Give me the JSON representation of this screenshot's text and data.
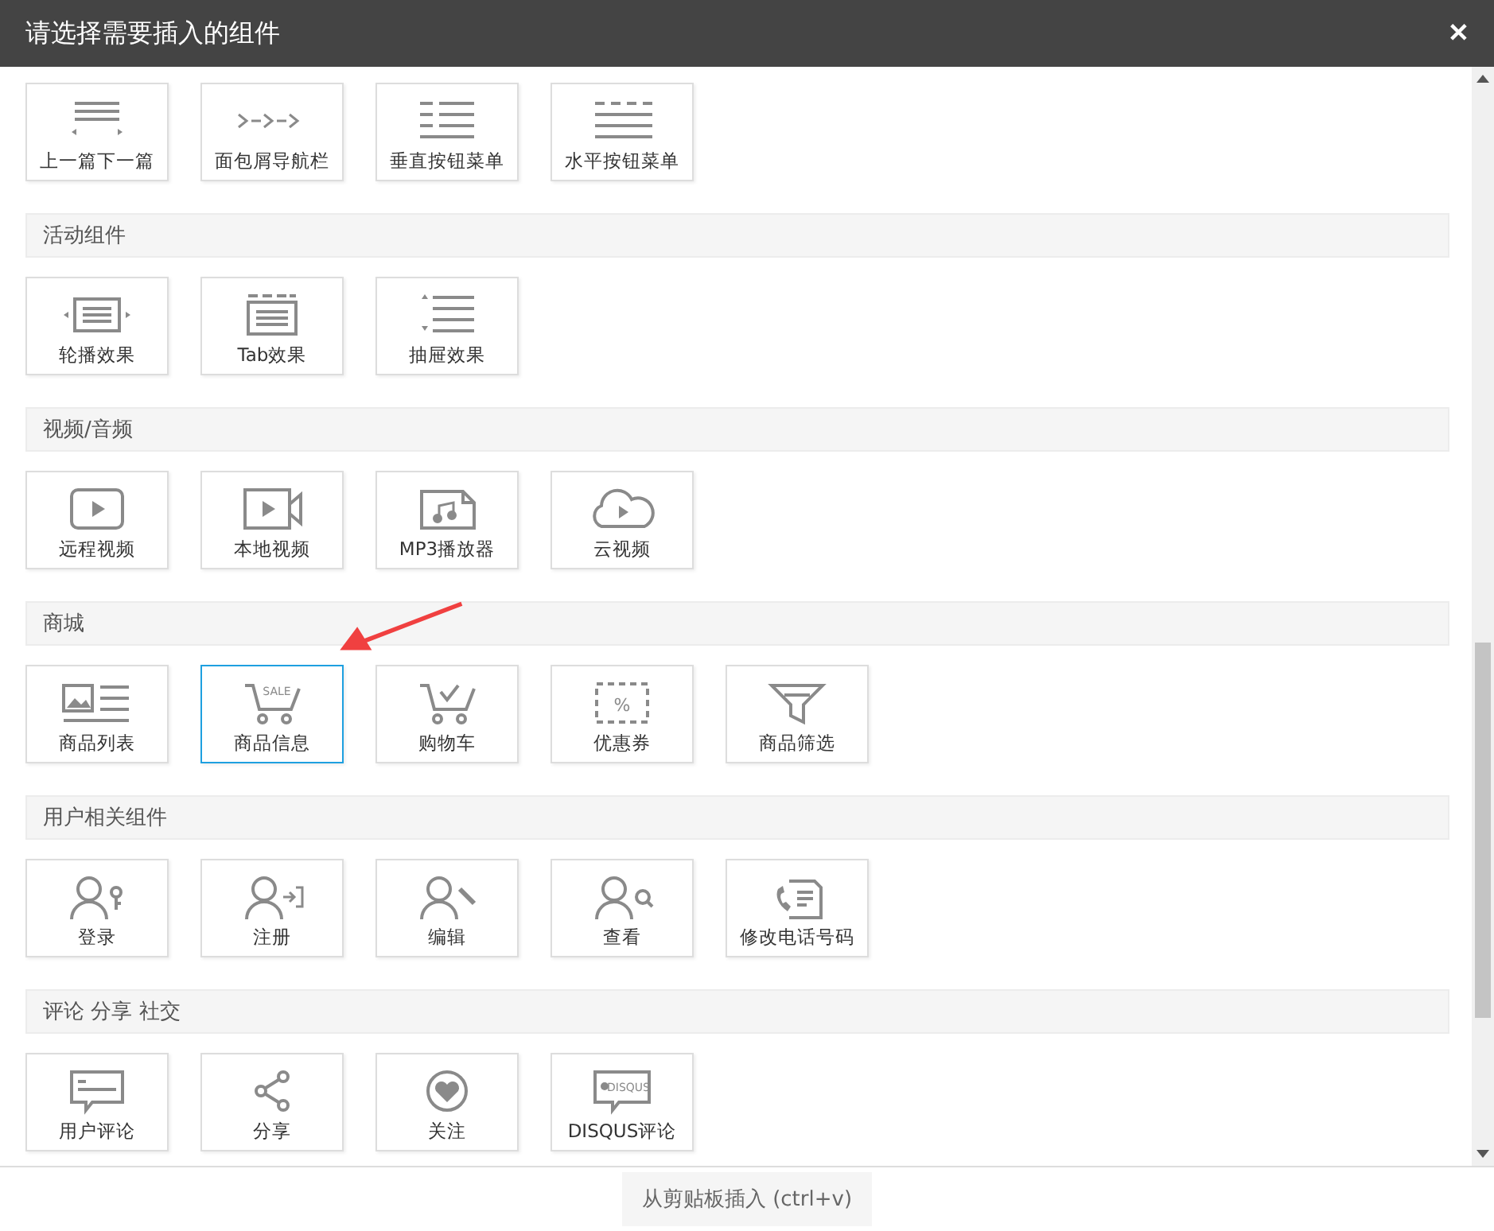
{
  "window": {
    "title": "请选择需要插入的组件",
    "close": "✕"
  },
  "sections": [
    {
      "items": [
        {
          "label": "上一篇下一篇",
          "kind": "prevnext",
          "selected": false
        },
        {
          "label": "面包屑导航栏",
          "kind": "breadcrumb",
          "selected": false
        },
        {
          "label": "垂直按钮菜单",
          "kind": "vmenu",
          "selected": false
        },
        {
          "label": "水平按钮菜单",
          "kind": "hmenu",
          "selected": false
        }
      ]
    },
    {
      "title": "活动组件",
      "items": [
        {
          "label": "轮播效果",
          "kind": "carousel",
          "selected": false
        },
        {
          "label": "Tab效果",
          "kind": "tab",
          "selected": false
        },
        {
          "label": "抽屉效果",
          "kind": "drawer",
          "selected": false
        }
      ]
    },
    {
      "title": "视频/音频",
      "items": [
        {
          "label": "远程视频",
          "kind": "video",
          "selected": false
        },
        {
          "label": "本地视频",
          "kind": "camera",
          "selected": false
        },
        {
          "label": "MP3播放器",
          "kind": "audio",
          "selected": false
        },
        {
          "label": "云视频",
          "kind": "cloud",
          "selected": false
        }
      ]
    },
    {
      "title": "商城",
      "items": [
        {
          "label": "商品列表",
          "kind": "productlist",
          "selected": false
        },
        {
          "label": "商品信息",
          "kind": "salecart",
          "icon_text": "SALE",
          "selected": true
        },
        {
          "label": "购物车",
          "kind": "cart",
          "selected": false
        },
        {
          "label": "优惠券",
          "kind": "coupon",
          "icon_text": "%",
          "selected": false
        },
        {
          "label": "商品筛选",
          "kind": "filter",
          "selected": false
        }
      ]
    },
    {
      "title": "用户相关组件",
      "items": [
        {
          "label": "登录",
          "kind": "userkey",
          "selected": false
        },
        {
          "label": "注册",
          "kind": "userenter",
          "selected": false
        },
        {
          "label": "编辑",
          "kind": "userpen",
          "selected": false
        },
        {
          "label": "查看",
          "kind": "usersearch",
          "selected": false
        },
        {
          "label": "修改电话号码",
          "kind": "phone",
          "selected": false
        }
      ]
    },
    {
      "title": "评论 分享 社交",
      "items": [
        {
          "label": "用户评论",
          "kind": "comment",
          "selected": false
        },
        {
          "label": "分享",
          "kind": "share",
          "selected": false
        },
        {
          "label": "关注",
          "kind": "heart",
          "selected": false
        },
        {
          "label": "DISQUS评论",
          "kind": "disqus",
          "icon_text": "DISQUS",
          "selected": false
        }
      ]
    }
  ],
  "footer": {
    "button": "从剪贴板插入 (ctrl+v)"
  }
}
